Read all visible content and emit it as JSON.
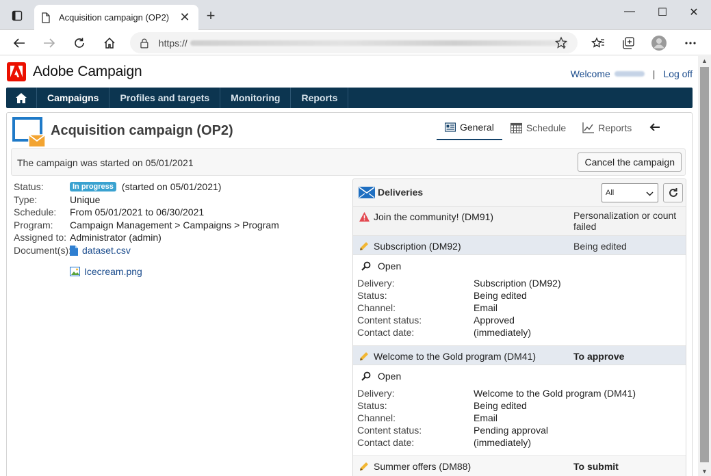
{
  "browser": {
    "tab_title": "Acquisition campaign (OP2)",
    "url_prefix": "https://"
  },
  "app": {
    "brand": "Adobe Campaign",
    "welcome_label": "Welcome",
    "logoff_label": "Log off"
  },
  "nav": {
    "items": [
      "Campaigns",
      "Profiles and targets",
      "Monitoring",
      "Reports"
    ],
    "active": "Campaigns"
  },
  "campaign": {
    "title": "Acquisition campaign (OP2)",
    "tabs": [
      "General",
      "Schedule",
      "Reports"
    ],
    "active_tab": "General",
    "start_message": "The campaign was started on 05/01/2021",
    "cancel_label": "Cancel the campaign",
    "properties": {
      "status_label": "Status:",
      "status_badge": "In progress",
      "status_note": "(started on 05/01/2021)",
      "type_label": "Type:",
      "type_value": "Unique",
      "schedule_label": "Schedule:",
      "schedule_value": "From 05/01/2021 to 06/30/2021",
      "program_label": "Program:",
      "program_value": "Campaign Management > Campaigns > Program",
      "assigned_label": "Assigned to:",
      "assigned_value": "Administrator (admin)",
      "documents_label": "Document(s):",
      "documents": [
        "dataset.csv",
        "Icecream.png"
      ]
    }
  },
  "deliveries": {
    "title": "Deliveries",
    "filter_value": "All",
    "rows": [
      {
        "name": "Join the community! (DM91)",
        "status": "Personalization or count failed",
        "status_line1": "Personalization or count",
        "status_line2": "failed"
      },
      {
        "name": "Subscription (DM92)",
        "status": "Being edited"
      },
      {
        "name": "Welcome to the Gold program (DM41)",
        "status": "To approve"
      },
      {
        "name": "Summer offers (DM88)",
        "status": "To submit"
      }
    ],
    "open_label": "Open",
    "detail_labels": [
      "Delivery:",
      "Status:",
      "Channel:",
      "Content status:",
      "Contact date:"
    ],
    "details": [
      {
        "values": [
          "Subscription (DM92)",
          "Being edited",
          "Email",
          "Approved",
          "(immediately)"
        ]
      },
      {
        "values": [
          "Welcome to the Gold program (DM41)",
          "Being edited",
          "Email",
          "Pending approval",
          "(immediately)"
        ]
      }
    ]
  }
}
